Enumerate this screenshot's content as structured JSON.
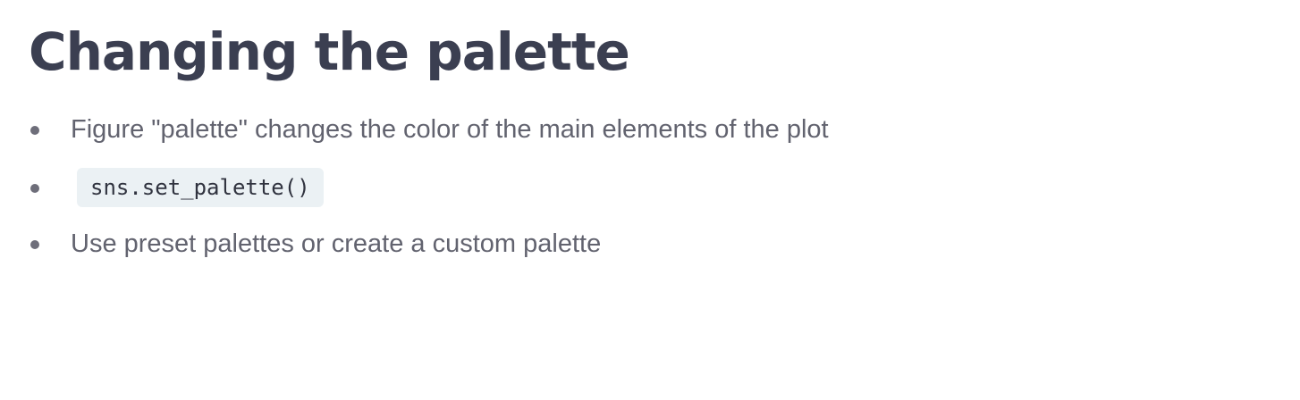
{
  "slide": {
    "title": "Changing the palette",
    "bullets": [
      {
        "text": "Figure \"palette\" changes the color of the main elements of the plot"
      },
      {
        "code": "sns.set_palette()"
      },
      {
        "text": "Use preset palettes or create a custom palette"
      }
    ]
  },
  "colors": {
    "title": "#3b3f51",
    "body_text": "#62636f",
    "code_background": "#ebf1f4",
    "code_text": "#30333f",
    "bullet": "#6e6e7a"
  }
}
